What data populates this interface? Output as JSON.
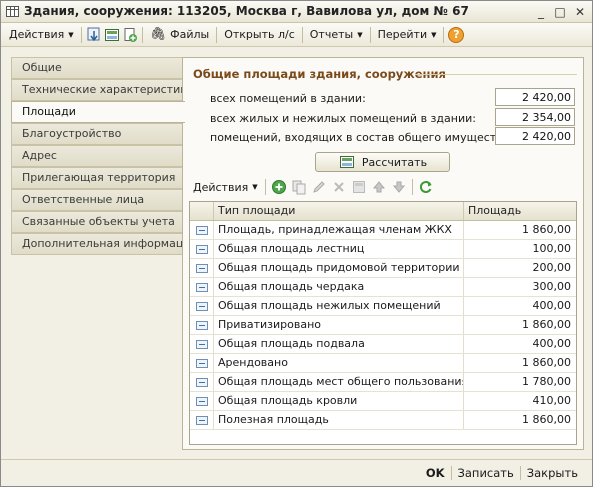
{
  "window": {
    "title": "Здания, сооружения: 113205, Москва г, Вавилова ул, дом № 67",
    "minimize": "_",
    "maximize": "□",
    "close": "✕"
  },
  "toolbar": {
    "actions": "Действия",
    "files": "Файлы",
    "open_account": "Открыть л/с",
    "reports": "Отчеты",
    "goto": "Перейти",
    "help": "?"
  },
  "nav": {
    "items": [
      {
        "label": "Общие"
      },
      {
        "label": "Технические характеристики"
      },
      {
        "label": "Площади"
      },
      {
        "label": "Благоустройство"
      },
      {
        "label": "Адрес"
      },
      {
        "label": "Прилегающая территория"
      },
      {
        "label": "Ответственные лица"
      },
      {
        "label": "Связанные объекты учета"
      },
      {
        "label": "Дополнительная информация"
      }
    ],
    "active_index": 2
  },
  "areas": {
    "group_title": "Общие площади здания, сооружения",
    "fields": [
      {
        "label": "всех помещений в здании:",
        "value": "2 420,00"
      },
      {
        "label": "всех жилых и нежилых помещений в здании:",
        "value": "2 354,00"
      },
      {
        "label": "помещений, входящих в состав общего имущества:",
        "value": "2 420,00"
      }
    ],
    "calculate_label": "Рассчитать"
  },
  "table": {
    "actions_label": "Действия",
    "columns": [
      "Тип площади",
      "Площадь"
    ],
    "rows": [
      {
        "type": "Площадь, принадлежащая членам ЖКХ",
        "area": "1 860,00"
      },
      {
        "type": "Общая площадь лестниц",
        "area": "100,00"
      },
      {
        "type": "Общая площадь придомовой территории",
        "area": "200,00"
      },
      {
        "type": "Общая площадь чердака",
        "area": "300,00"
      },
      {
        "type": "Общая площадь нежилых помещений",
        "area": "400,00"
      },
      {
        "type": "Приватизировано",
        "area": "1 860,00"
      },
      {
        "type": "Общая площадь подвала",
        "area": "400,00"
      },
      {
        "type": "Арендовано",
        "area": "1 860,00"
      },
      {
        "type": "Общая площадь мест общего пользования",
        "area": "1 780,00"
      },
      {
        "type": "Общая площадь кровли",
        "area": "410,00"
      },
      {
        "type": "Полезная площадь",
        "area": "1 860,00"
      }
    ]
  },
  "footer": {
    "ok": "OK",
    "save": "Записать",
    "close": "Закрыть"
  },
  "colors": {
    "accent_title": "#7a4a1a",
    "window_bg": "#f2f0e4",
    "panel_bg": "#fbfaf6"
  }
}
